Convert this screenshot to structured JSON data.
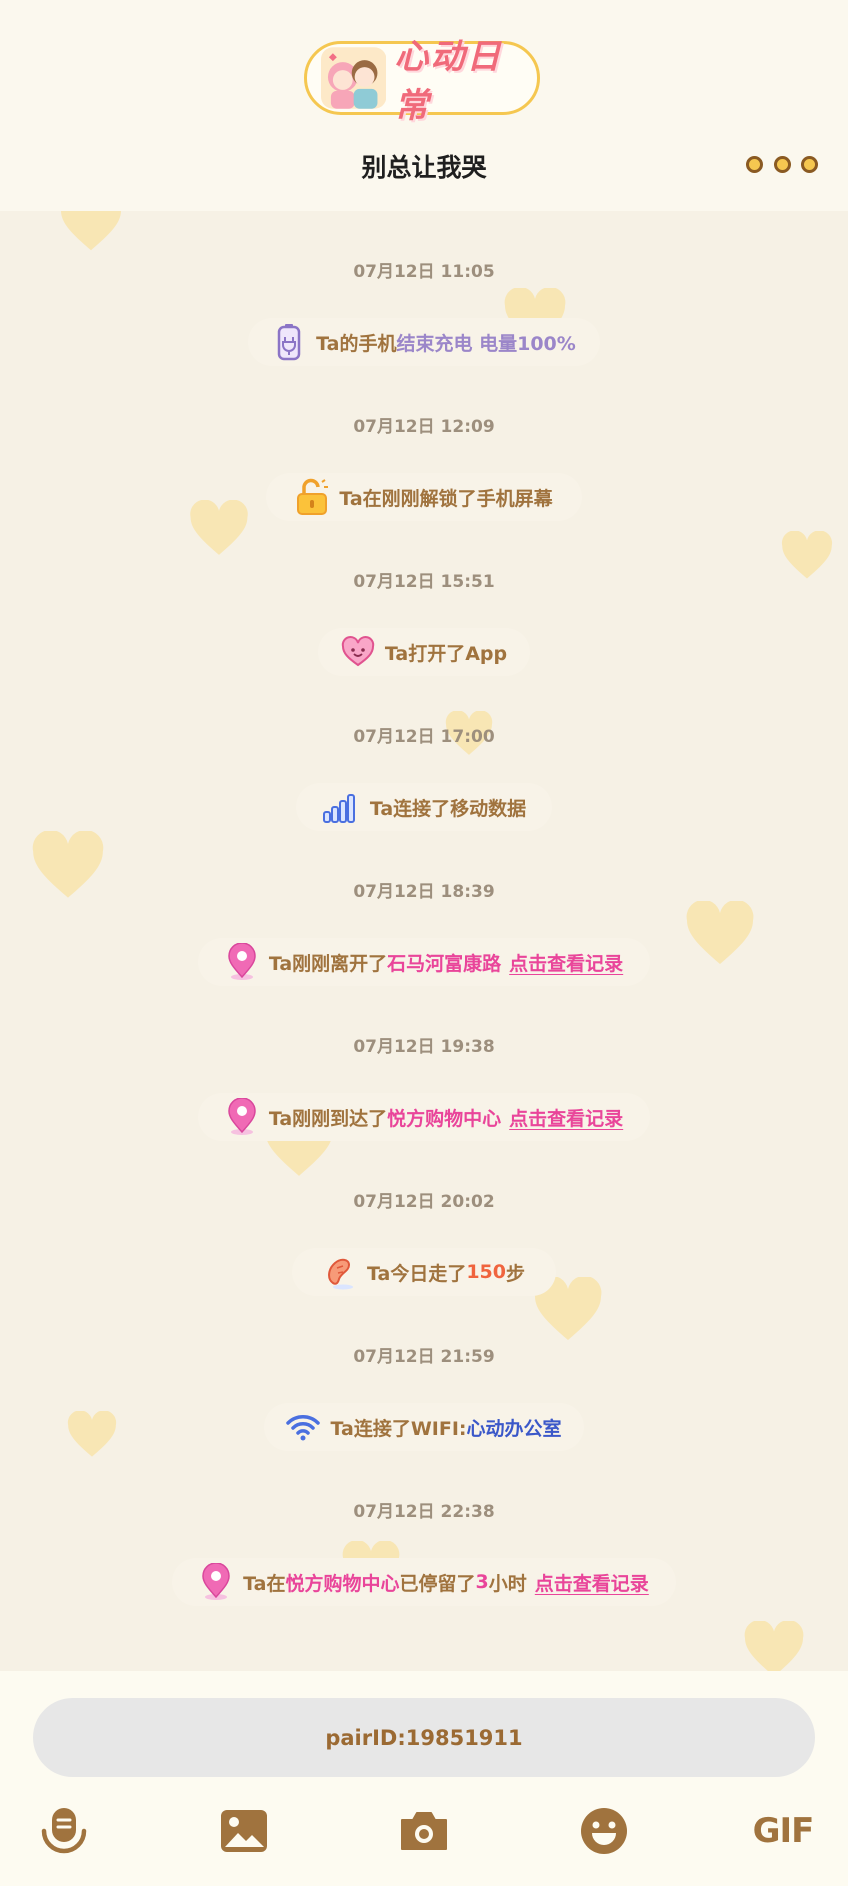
{
  "header": {
    "logo_text": "心动日常",
    "title": "别总让我哭"
  },
  "feed": {
    "events": [
      {
        "time": "07月12日 11:05",
        "icon": "battery-plug-icon",
        "parts": [
          {
            "text": "Ta的手机",
            "style": "normal"
          },
          {
            "text": "结束充电 电量100%",
            "style": "purple"
          }
        ]
      },
      {
        "time": "07月12日 12:09",
        "icon": "unlock-icon",
        "parts": [
          {
            "text": "Ta在刚刚解锁了手机屏幕",
            "style": "normal"
          }
        ]
      },
      {
        "time": "07月12日 15:51",
        "icon": "heart-face-icon",
        "parts": [
          {
            "text": "Ta打开了App",
            "style": "normal"
          }
        ]
      },
      {
        "time": "07月12日 17:00",
        "icon": "signal-bars-icon",
        "parts": [
          {
            "text": "Ta连接了移动数据",
            "style": "normal"
          }
        ]
      },
      {
        "time": "07月12日 18:39",
        "icon": "location-pin-icon",
        "parts": [
          {
            "text": "Ta刚刚离开了",
            "style": "normal"
          },
          {
            "text": "石马河富康路",
            "style": "pink"
          }
        ],
        "link": "点击查看记录"
      },
      {
        "time": "07月12日 19:38",
        "icon": "location-pin-icon",
        "parts": [
          {
            "text": "Ta刚刚到达了",
            "style": "normal"
          },
          {
            "text": "悦方购物中心",
            "style": "pink"
          }
        ],
        "link": "点击查看记录"
      },
      {
        "time": "07月12日 20:02",
        "icon": "footprint-icon",
        "parts": [
          {
            "text": "Ta今日走了 ",
            "style": "normal"
          },
          {
            "text": "150",
            "style": "orange"
          },
          {
            "text": " 步",
            "style": "normal"
          }
        ]
      },
      {
        "time": "07月12日 21:59",
        "icon": "wifi-icon",
        "parts": [
          {
            "text": "Ta连接了WIFI:",
            "style": "normal"
          },
          {
            "text": "心动办公室",
            "style": "blue"
          }
        ]
      },
      {
        "time": "07月12日 22:38",
        "icon": "location-pin-icon",
        "parts": [
          {
            "text": "Ta在",
            "style": "normal"
          },
          {
            "text": "悦方购物中心",
            "style": "pink"
          },
          {
            "text": "已停留了",
            "style": "normal"
          },
          {
            "text": "3",
            "style": "pink"
          },
          {
            "text": "小时",
            "style": "normal"
          }
        ],
        "link": "点击查看记录"
      }
    ]
  },
  "input": {
    "text": "pairID:19851911"
  },
  "toolbar": {
    "items": [
      "voice-icon",
      "image-icon",
      "camera-icon",
      "emoji-icon",
      "gif-icon"
    ],
    "gif_label": "GIF"
  },
  "colors": {
    "accent_brown": "#a0733e",
    "pink": "#e9459a",
    "purple": "#9b86c9",
    "orange": "#f0643e",
    "blue": "#3b58c9",
    "yellow": "#f5c750"
  }
}
